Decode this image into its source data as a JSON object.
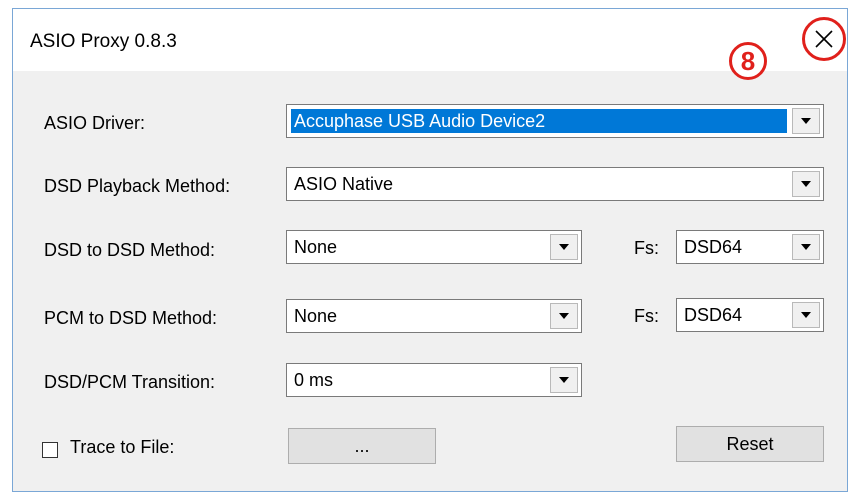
{
  "window": {
    "title": "ASIO Proxy 0.8.3",
    "annotation": "8"
  },
  "fields": {
    "asio_driver": {
      "label": "ASIO Driver:",
      "value": "Accuphase USB Audio Device2"
    },
    "dsd_playback": {
      "label": "DSD Playback Method:",
      "value": "ASIO Native"
    },
    "dsd_to_dsd": {
      "label": "DSD to DSD Method:",
      "value": "None",
      "fs_label": "Fs:",
      "fs_value": "DSD64"
    },
    "pcm_to_dsd": {
      "label": "PCM to DSD Method:",
      "value": "None",
      "fs_label": "Fs:",
      "fs_value": "DSD64"
    },
    "transition": {
      "label": "DSD/PCM Transition:",
      "value": "0 ms"
    }
  },
  "trace": {
    "label": "Trace to File:",
    "browse_label": "...",
    "checked": false
  },
  "reset_label": "Reset",
  "colors": {
    "selection": "#0078d7",
    "annotation": "#e0201b",
    "window_border": "#7aa7d6"
  }
}
